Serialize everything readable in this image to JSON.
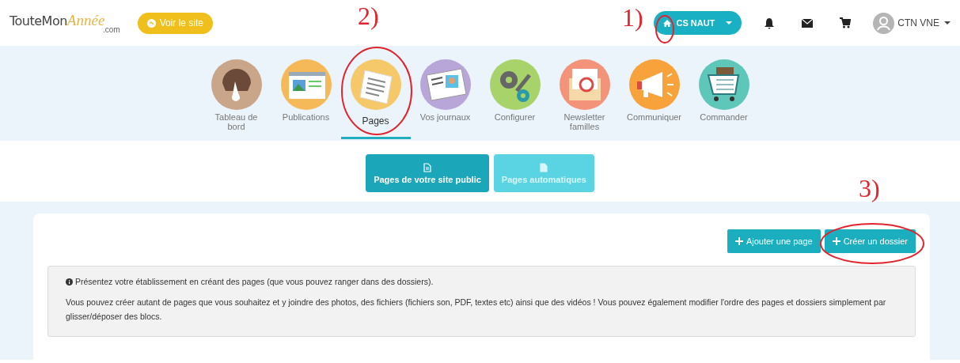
{
  "header": {
    "logo": {
      "name": "TouteMon",
      "accent": "Année",
      "domain": ".com"
    },
    "view_site_button": "Voir le site",
    "school_menu": "CS NAUT",
    "user_menu": "CTN VNE"
  },
  "nav": [
    {
      "label": "Tableau de bord",
      "selected": false
    },
    {
      "label": "Publications",
      "selected": false
    },
    {
      "label": "Pages",
      "selected": true
    },
    {
      "label": "Vos journaux",
      "selected": false
    },
    {
      "label": "Configurer",
      "selected": false
    },
    {
      "label": "Newsletter familles",
      "selected": false
    },
    {
      "label": "Communiquer",
      "selected": false
    },
    {
      "label": "Commander",
      "selected": false
    }
  ],
  "tabs": [
    {
      "label": "Pages de votre site public",
      "selected": true
    },
    {
      "label": "Pages automatiques",
      "selected": false
    }
  ],
  "actions": [
    "Ajouter une page",
    "Créer un dossier"
  ],
  "info": [
    "Présentez votre établissement en créant des pages (que vous pouvez ranger dans des dossiers).",
    "Vous pouvez créer autant de pages que vous souhaitez et y joindre des photos, des fichiers (fichiers son, PDF, textes etc) ainsi que des vidéos ! Vous pouvez également modifier l'ordre des pages et dossiers simplement par glisser/déposer des blocs."
  ],
  "annotations": [
    {
      "label": "1)"
    },
    {
      "label": "2)"
    },
    {
      "label": "3)"
    }
  ]
}
